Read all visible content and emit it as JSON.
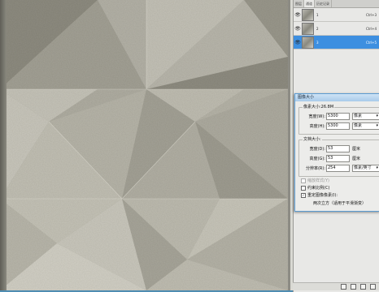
{
  "layers_panel": {
    "tabs": [
      "图层",
      "通道",
      "历史记录"
    ],
    "active_tab": 1,
    "layers": [
      {
        "name": "1",
        "shortcut": "Ctrl+3",
        "visible": true,
        "selected": false
      },
      {
        "name": "2",
        "shortcut": "Ctrl+4",
        "visible": true,
        "selected": false
      },
      {
        "name": "3",
        "shortcut": "Ctrl+5",
        "visible": true,
        "selected": true
      }
    ]
  },
  "dialog": {
    "title": "图像大小",
    "pixel_dimensions": {
      "label": "像素大小:26.8M",
      "width_label": "宽度(W):",
      "width_value": "5300",
      "width_unit": "像素",
      "height_label": "高度(H):",
      "height_value": "5300",
      "height_unit": "像素"
    },
    "document_size": {
      "label": "文档大小:",
      "width_label": "宽度(D):",
      "width_value": "53",
      "width_unit": "厘米",
      "height_label": "高度(G):",
      "height_value": "53",
      "height_unit": "厘米",
      "resolution_label": "分辨率(R):",
      "resolution_value": "254",
      "resolution_unit": "像素/英寸"
    },
    "scale_styles": "缩放样式(Y)",
    "constrain_proportions": "约束比例(C)",
    "resample_image": "重定图像像素(I):",
    "method": "两次立方（适用于平滑渐变）"
  },
  "colors": {
    "selection": "#3d8fe0",
    "dialog_border": "#5b9bd0"
  }
}
